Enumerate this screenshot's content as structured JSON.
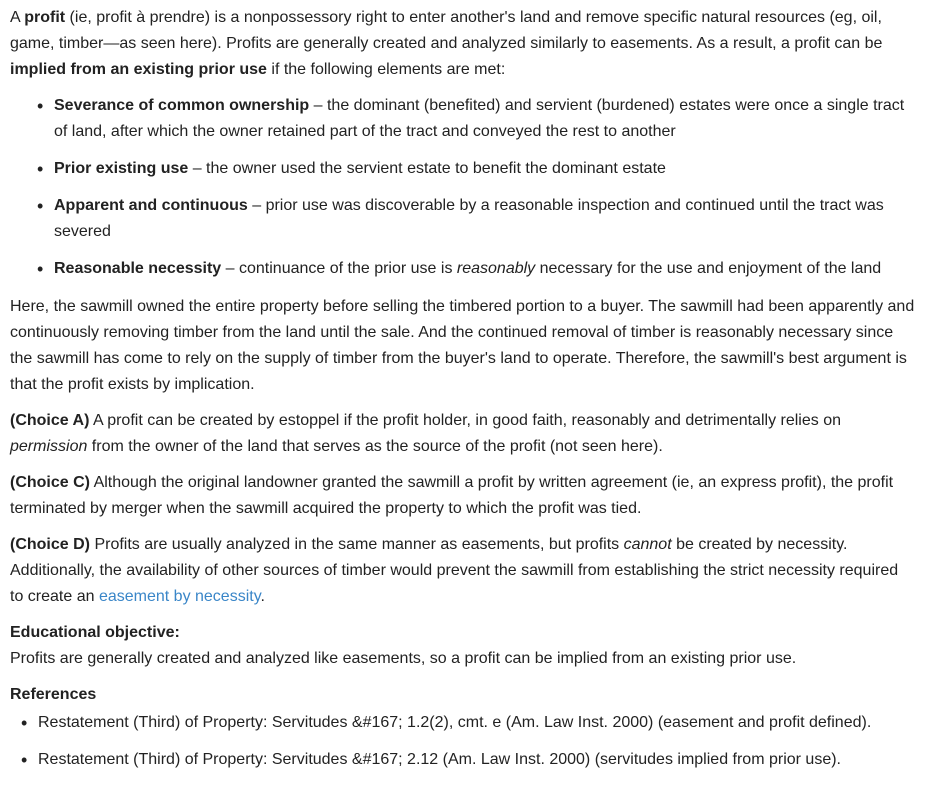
{
  "intro": {
    "t1": "A ",
    "profit_bold": "profit",
    "t2": " (ie, profit à prendre) is a nonpossessory right to enter another's land and remove specific natural resources (eg, oil, game, timber—as seen here).  Profits are generally created and analyzed similarly to easements.  As a result, a profit can be ",
    "implied_bold": "implied from an existing prior use",
    "t3": " if the following elements are met:"
  },
  "elements": [
    {
      "term": "Severance of common ownership",
      "desc": " – the dominant (benefited) and servient (burdened) estates were once a single tract of land, after which the owner retained part of the tract and conveyed the rest to another"
    },
    {
      "term": "Prior existing use",
      "desc": " – the owner used the servient estate to benefit the dominant estate"
    },
    {
      "term": "Apparent and continuous",
      "desc": " – prior use was discoverable by a reasonable inspection and continued until the tract was severed"
    },
    {
      "term": "Reasonable necessity",
      "desc_a": " – continuance of the prior use is ",
      "desc_italic": "reasonably",
      "desc_b": " necessary for the use and enjoyment of the land"
    }
  ],
  "analysis": "Here, the sawmill owned the entire property before selling the timbered portion to a buyer.  The sawmill had been apparently and continuously removing timber from the land until the sale.  And the continued removal of timber is reasonably necessary since the sawmill has come to rely on the supply of timber from the buyer's land to operate.  Therefore, the sawmill's best argument is that the profit exists by implication.",
  "choice_a": {
    "label": "(Choice A)",
    "t1": "  A profit can be created by estoppel if the profit holder, in good faith, reasonably and detrimentally relies on ",
    "italic": "permission",
    "t2": " from the owner of the land that serves as the source of the profit (not seen here)."
  },
  "choice_c": {
    "label": "(Choice C)",
    "t1": "  Although the original landowner granted the sawmill a profit by written agreement (ie, an express profit), the profit terminated by merger when the sawmill acquired the property to which the profit was tied."
  },
  "choice_d": {
    "label": "(Choice D)",
    "t1": "  Profits are usually analyzed in the same manner as easements, but profits ",
    "italic": "cannot",
    "t2": " be created by necessity.  Additionally, the availability of other sources of timber would prevent the sawmill from establishing the strict necessity required to create an ",
    "link": "easement by necessity",
    "t3": "."
  },
  "objective": {
    "title": "Educational objective:",
    "text": "Profits are generally created and analyzed like easements, so a profit can be implied from an existing prior use."
  },
  "references": {
    "title": "References",
    "items": [
      "Restatement (Third) of Property: Servitudes &#167; 1.2(2), cmt. e (Am. Law Inst. 2000) (easement and profit defined).",
      "Restatement (Third) of Property: Servitudes &#167; 2.12 (Am. Law Inst. 2000) (servitudes implied from prior use)."
    ]
  },
  "colors": {
    "text": "#222222",
    "link": "#3a86c8",
    "background": "#ffffff"
  }
}
